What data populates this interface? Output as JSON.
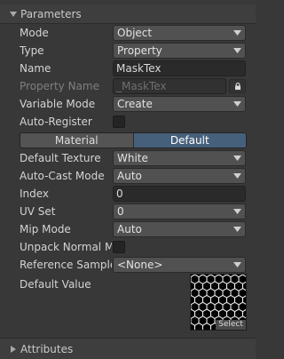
{
  "sections": {
    "parameters": "Parameters",
    "attributes": "Attributes"
  },
  "fields": {
    "mode": {
      "label": "Mode",
      "value": "Object"
    },
    "type": {
      "label": "Type",
      "value": "Property"
    },
    "name": {
      "label": "Name",
      "value": "MaskTex"
    },
    "property_name": {
      "label": "Property Name",
      "value": "_MaskTex"
    },
    "variable_mode": {
      "label": "Variable Mode",
      "value": "Create"
    },
    "auto_register": {
      "label": "Auto-Register",
      "checked": false
    },
    "default_texture": {
      "label": "Default Texture",
      "value": "White"
    },
    "auto_cast_mode": {
      "label": "Auto-Cast Mode",
      "value": "Auto"
    },
    "index": {
      "label": "Index",
      "value": "0"
    },
    "uv_set": {
      "label": "UV Set",
      "value": "0"
    },
    "mip_mode": {
      "label": "Mip Mode",
      "value": "Auto"
    },
    "unpack_normal_map": {
      "label": "Unpack Normal Ma",
      "checked": false
    },
    "reference_sampler": {
      "label": "Reference Sample",
      "value": "<None>"
    },
    "default_value": {
      "label": "Default Value",
      "select_label": "Select"
    }
  },
  "tabs": [
    {
      "label": "Material",
      "active": false
    },
    {
      "label": "Default",
      "active": true
    }
  ],
  "icons": {
    "foldout_open": "chevron-down-icon",
    "foldout_closed": "chevron-right-icon",
    "lock": "lock-icon",
    "dropdown": "caret-down-icon"
  },
  "colors": {
    "panel_bg": "#383838",
    "active_tab": "#46607c",
    "field_bg": "#2a2a2a",
    "dropdown_bg": "#515151"
  }
}
